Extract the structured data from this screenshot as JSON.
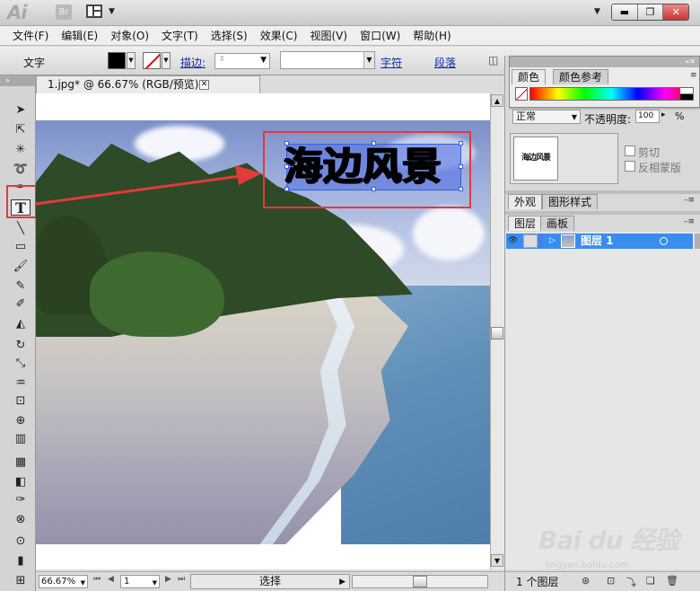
{
  "app": {
    "logo_text": "Ai",
    "bridge_text": "Br"
  },
  "window_controls": {
    "minimize": "▬",
    "restore": "❐",
    "close": "✕"
  },
  "menu": [
    "文件(F)",
    "编辑(E)",
    "对象(O)",
    "文字(T)",
    "选择(S)",
    "效果(C)",
    "视图(V)",
    "窗口(W)",
    "帮助(H)"
  ],
  "control_bar": {
    "tool_label": "文字",
    "stroke_label": "描边:",
    "character_link": "字符",
    "paragraph_link": "段落"
  },
  "document": {
    "tab_title": "1.jpg* @ 66.67% (RGB/预览)",
    "close_glyph": "✕",
    "artwork_text": "海边风景"
  },
  "status_bar": {
    "zoom": "66.67%",
    "page": "1",
    "status_text": "选择"
  },
  "color_panel": {
    "tabs": [
      "颜色",
      "颜色参考"
    ],
    "blend_mode": "正常",
    "opacity_label": "不透明度:",
    "opacity_value": "100",
    "opacity_unit": "%"
  },
  "transparency": {
    "thumbnail_text": "海边风景",
    "clip_label": "剪切",
    "invert_mask_label": "反相蒙版"
  },
  "appearance_panel": {
    "tabs": [
      "外观",
      "图形样式"
    ]
  },
  "layers_panel": {
    "tabs": [
      "图层",
      "画板"
    ],
    "layers": [
      {
        "name": "图层 1",
        "color": "#4a7fe4"
      }
    ],
    "footer_count": "1 个图层"
  },
  "watermark": {
    "main": "Bai du 经验",
    "sub": "jingyan.baidu.com"
  },
  "colors": {
    "annotation_red": "#e23a3a",
    "selection_blue": "#3b8ded"
  }
}
